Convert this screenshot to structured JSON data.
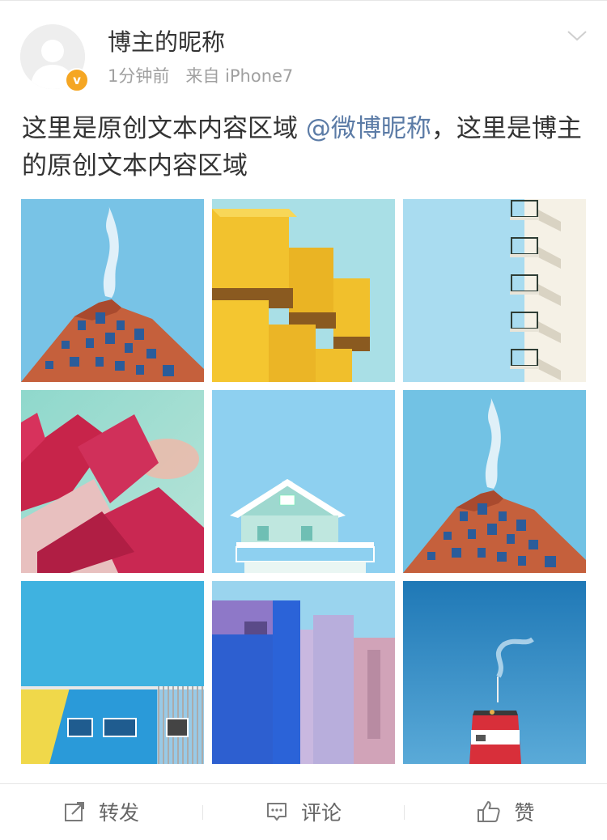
{
  "post": {
    "author": "博主的昵称",
    "verified_badge": "v",
    "time": "1分钟前",
    "source": "来自 iPhone7",
    "text_parts": [
      "这里是原创文本内容区域 ",
      "@微博昵称",
      "，这里是博主的原创文本内容区域"
    ],
    "images": [
      {
        "name": "photo-brick-building"
      },
      {
        "name": "photo-yellow-blocks"
      },
      {
        "name": "photo-balconies"
      },
      {
        "name": "photo-red-roofs"
      },
      {
        "name": "photo-mint-house"
      },
      {
        "name": "photo-brick-building-2"
      },
      {
        "name": "photo-blue-yellow-building"
      },
      {
        "name": "photo-blue-violet-walls"
      },
      {
        "name": "photo-lighthouse"
      }
    ]
  },
  "actions": {
    "repost": "转发",
    "comment": "评论",
    "like": "赞"
  },
  "icons": [
    "avatar-placeholder-icon",
    "verified-badge-icon",
    "chevron-down-icon",
    "repost-icon",
    "comment-icon",
    "thumb-up-icon"
  ],
  "colors": {
    "mention": "#5b7ba6",
    "badge": "#f5a623",
    "meta": "#a0a0a0"
  }
}
